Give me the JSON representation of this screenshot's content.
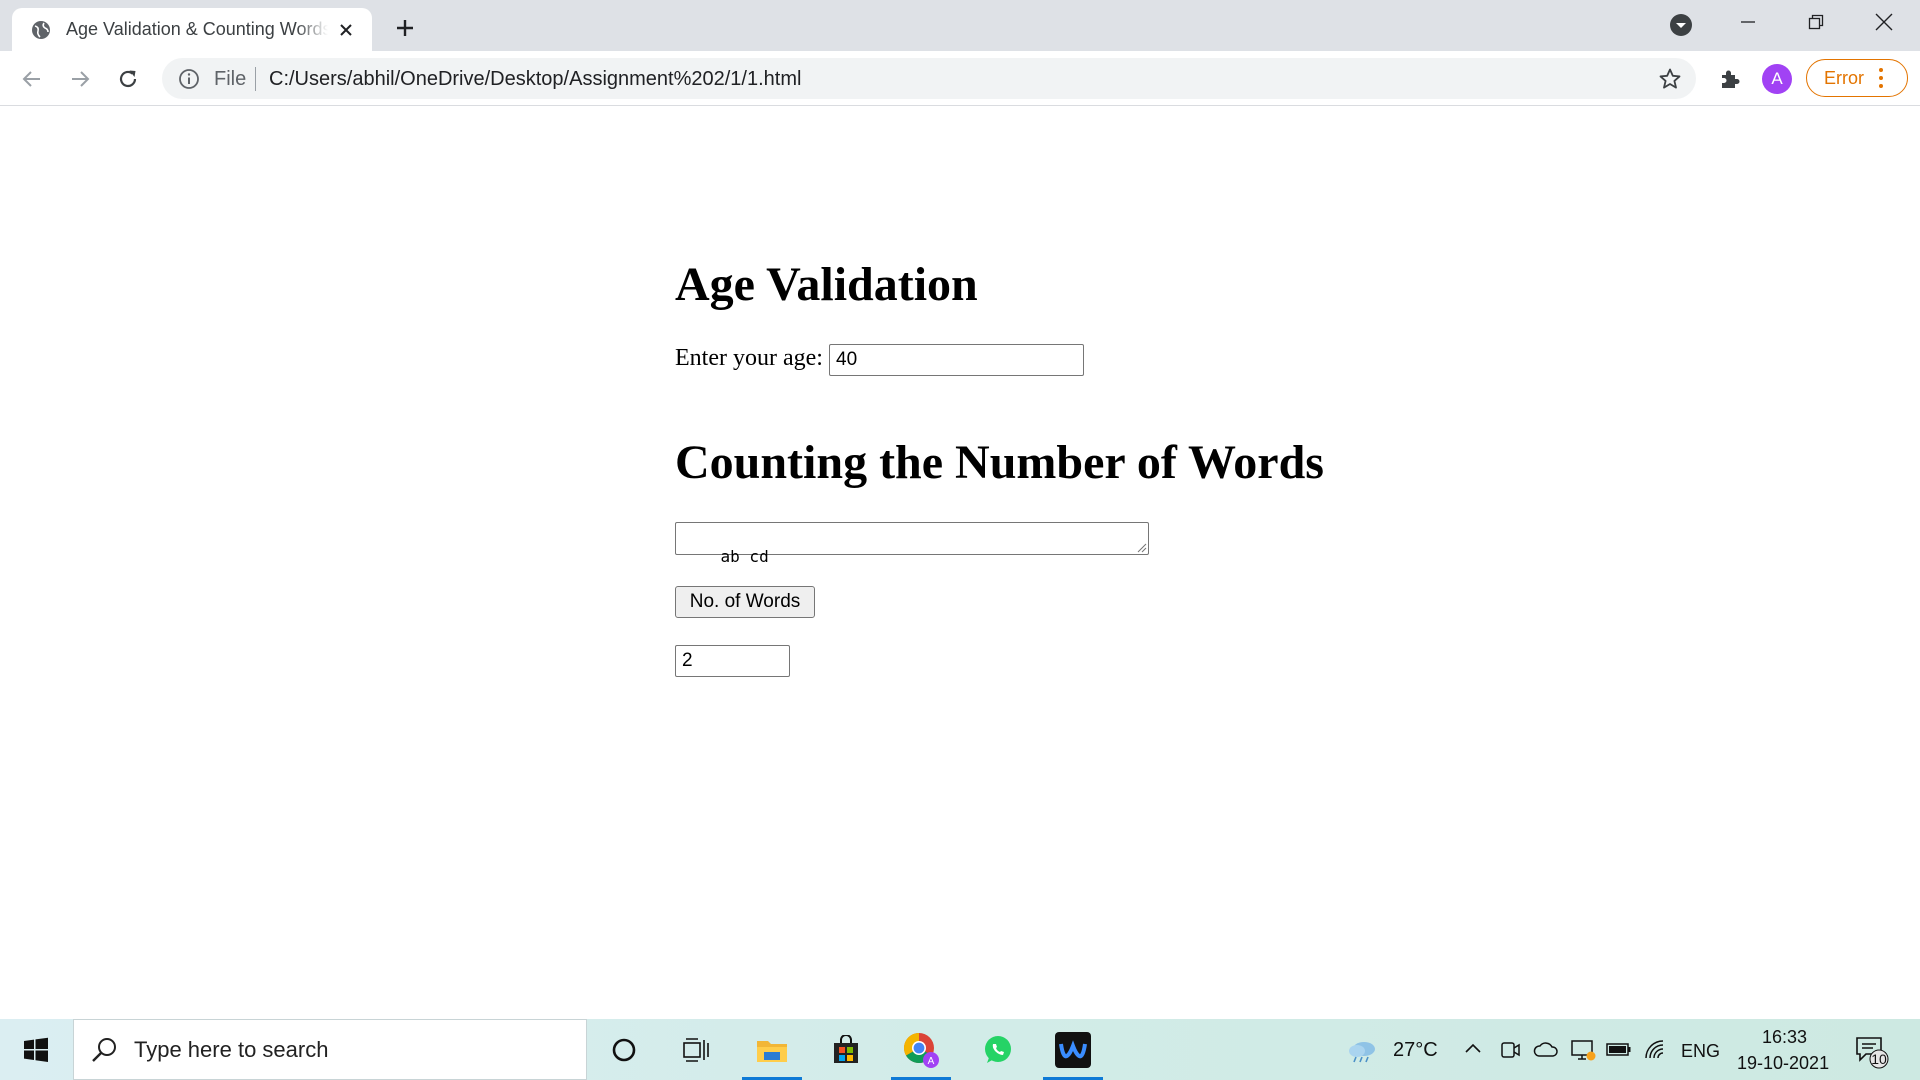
{
  "browser": {
    "tab_title": "Age Validation & Counting Words",
    "file_label": "File",
    "url": "C:/Users/abhil/OneDrive/Desktop/Assignment%202/1/1.html",
    "profile_initial": "A",
    "error_label": "Error"
  },
  "page": {
    "age_heading": "Age Validation",
    "age_label": "Enter your age:",
    "age_value": "40",
    "words_heading": "Counting the Number of Words",
    "words_text": "ab cd",
    "count_button": "No. of Words",
    "word_count": "2"
  },
  "taskbar": {
    "search_placeholder": "Type here to search",
    "temperature": "27°C",
    "language": "ENG",
    "time": "16:33",
    "date": "19-10-2021",
    "notification_count": "10"
  },
  "colors": {
    "accent_error": "#e37400",
    "avatar": "#a142f4",
    "taskbar_active": "#0f7ad6"
  }
}
